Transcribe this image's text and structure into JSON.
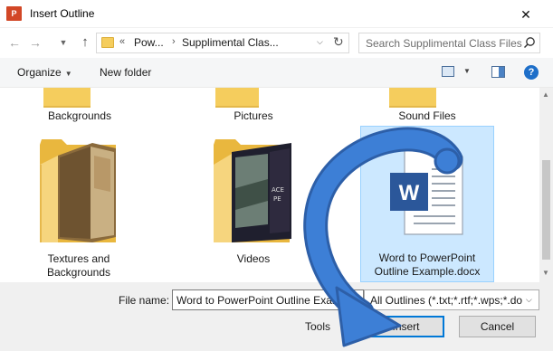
{
  "window": {
    "title": "Insert Outline",
    "app_icon_text": "P",
    "close_glyph": "✕"
  },
  "nav": {
    "back": "←",
    "forward": "→",
    "up": "↑",
    "address_chevron_left": "«",
    "address_segments": [
      "Pow...",
      "Supplimental Clas..."
    ],
    "address_separator": "›",
    "refresh": "↻",
    "search_placeholder": "Search Supplimental Class Files"
  },
  "toolbar": {
    "organize": "Organize",
    "new_folder": "New folder",
    "help": "?"
  },
  "items": [
    {
      "label": "Backgrounds",
      "type": "folder"
    },
    {
      "label": "Pictures",
      "type": "folder"
    },
    {
      "label": "Sound Files",
      "type": "folder"
    },
    {
      "label_line1": "Textures and",
      "label_line2": "Backgrounds",
      "type": "folder"
    },
    {
      "label": "Videos",
      "type": "folder"
    },
    {
      "label_line1": "Word to PowerPoint",
      "label_line2": "Outline Example.docx",
      "type": "docx",
      "selected": true
    }
  ],
  "doc_icon_letter": "W",
  "bottom": {
    "file_name_label": "File name:",
    "file_name_value": "Word to PowerPoint Outline Example.docx",
    "file_type_value": "All Outlines (*.txt;*.rtf;*.wps;*.docx)",
    "tools": "Tools",
    "insert": "Insert",
    "cancel": "Cancel"
  },
  "colors": {
    "folder": "#f0c24d",
    "selection": "#cce8ff",
    "accent": "#0078d7",
    "arrow": "#3d7fd6",
    "word_blue": "#2b579a"
  }
}
